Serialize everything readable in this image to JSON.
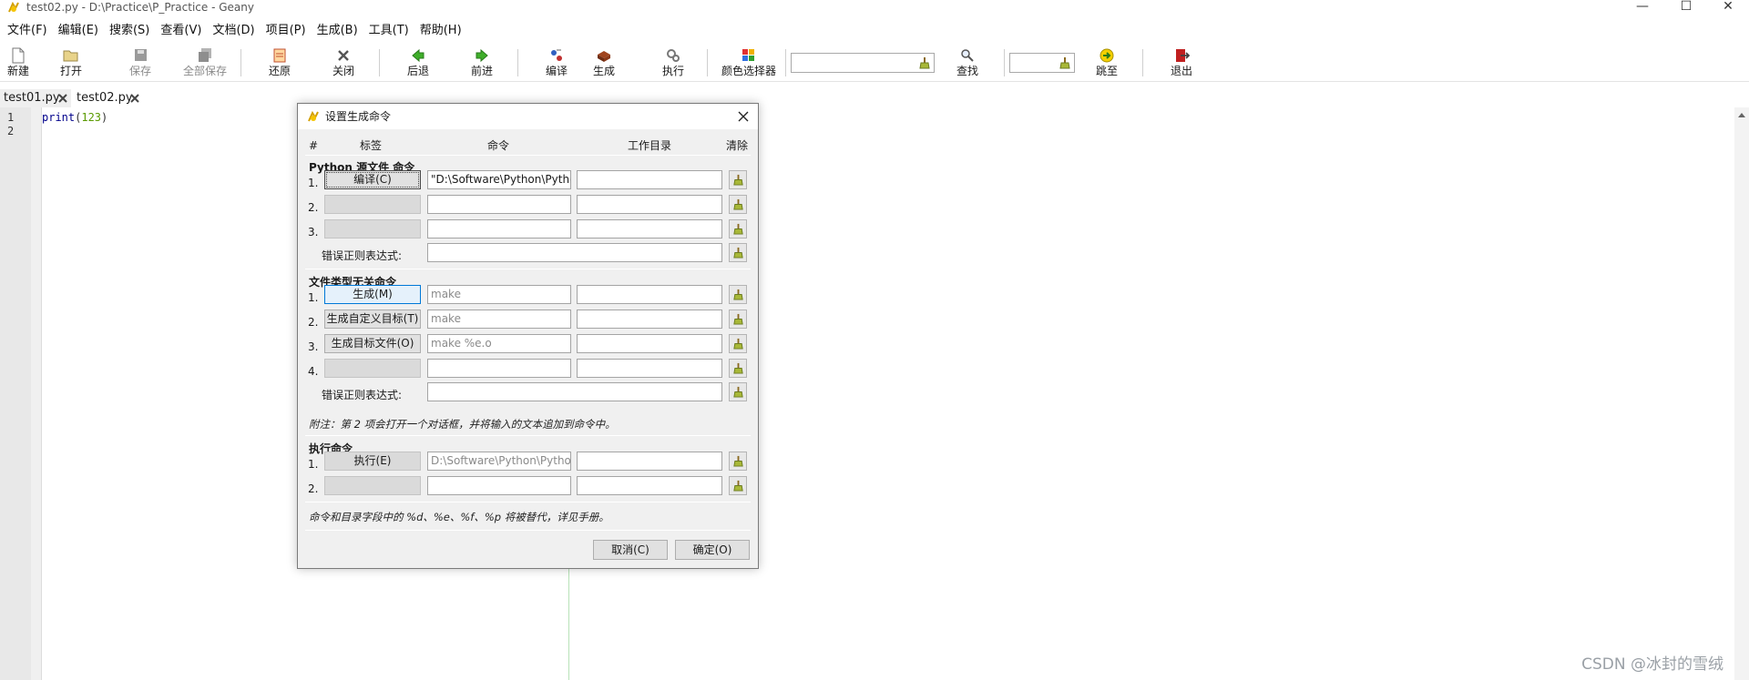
{
  "window": {
    "title": "test02.py - D:\\Practice\\P_Practice - Geany",
    "controls": {
      "minimize": "—",
      "maximize": "☐",
      "close": "✕"
    }
  },
  "menubar": [
    "文件(F)",
    "编辑(E)",
    "搜索(S)",
    "查看(V)",
    "文档(D)",
    "项目(P)",
    "生成(B)",
    "工具(T)",
    "帮助(H)"
  ],
  "toolbar": {
    "new": "新建",
    "open": "打开",
    "save": "保存",
    "save_all": "全部保存",
    "revert": "还原",
    "close": "关闭",
    "back": "后退",
    "forward": "前进",
    "compile": "编译",
    "build": "生成",
    "run": "执行",
    "color_chooser": "颜色选择器",
    "search_value": "",
    "find": "查找",
    "goto_value": "",
    "goto": "跳至",
    "quit": "退出"
  },
  "tabs": [
    {
      "label": "test01.py",
      "active": false
    },
    {
      "label": "test02.py",
      "active": true
    }
  ],
  "editor": {
    "line_numbers": [
      "1",
      "2"
    ],
    "code": {
      "fn": "print",
      "open": "(",
      "arg": "123",
      "close": ")"
    }
  },
  "watermark": "CSDN @冰封的雪绒",
  "dialog": {
    "title": "设置生成命令",
    "headers": {
      "num": "#",
      "label": "标签",
      "command": "命令",
      "workdir": "工作目录",
      "clear": "清除"
    },
    "python_section": {
      "title": "Python 源文件 命令",
      "rows": [
        {
          "no": "1.",
          "label": "编译(C)",
          "command": "\"D:\\Software\\Python\\Python",
          "workdir": ""
        },
        {
          "no": "2.",
          "label": "",
          "command": "",
          "workdir": ""
        },
        {
          "no": "3.",
          "label": "",
          "command": "",
          "workdir": ""
        }
      ],
      "regex_label": "错误正则表达式:",
      "regex_value": ""
    },
    "independent_section": {
      "title": "文件类型无关命令",
      "rows": [
        {
          "no": "1.",
          "label": "生成(M)",
          "command_placeholder": "make",
          "workdir": ""
        },
        {
          "no": "2.",
          "label": "生成自定义目标(T)",
          "command_placeholder": "make",
          "workdir": ""
        },
        {
          "no": "3.",
          "label": "生成目标文件(O)",
          "command_placeholder": "make %e.o",
          "workdir": ""
        },
        {
          "no": "4.",
          "label": "",
          "command_placeholder": "",
          "workdir": ""
        }
      ],
      "regex_label": "错误正则表达式:",
      "regex_value": "",
      "note": "附注：第 2 项会打开一个对话框，并将输入的文本追加到命令中。"
    },
    "execute_section": {
      "title": "执行命令",
      "rows": [
        {
          "no": "1.",
          "label": "执行(E)",
          "command_placeholder": "D:\\Software\\Python\\Python",
          "workdir": ""
        },
        {
          "no": "2.",
          "label": "",
          "command_placeholder": "",
          "workdir": ""
        }
      ]
    },
    "footer_note": "命令和目录字段中的 %d、%e、%f、%p 将被替代，详见手册。",
    "buttons": {
      "cancel": "取消(C)",
      "ok": "确定(O)"
    }
  },
  "colors": {
    "accent_blue": "#0078d7",
    "keyword": "#00008b",
    "number": "#5a9a00"
  }
}
